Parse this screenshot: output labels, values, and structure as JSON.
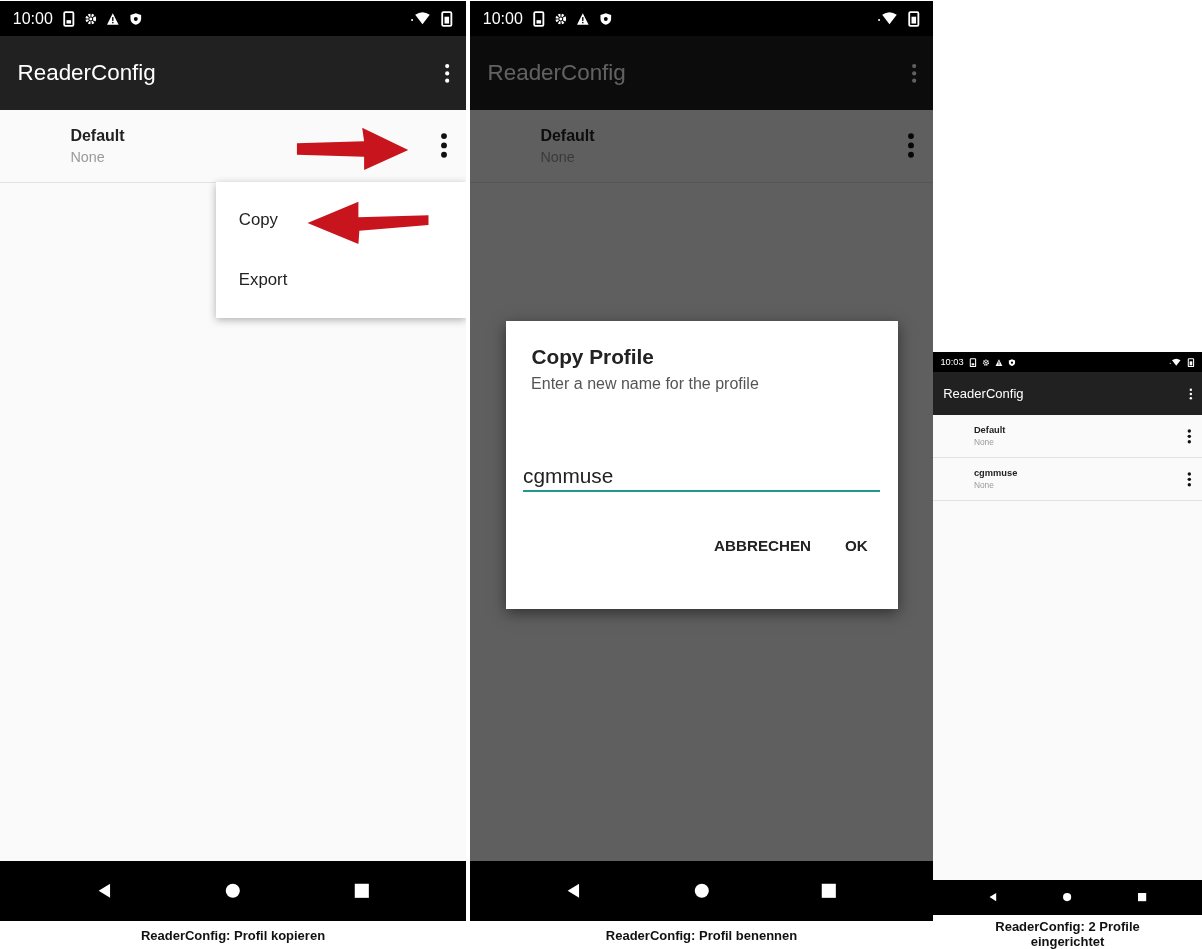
{
  "screens": [
    {
      "kind": "large",
      "status_bar": {
        "time": "10:00"
      },
      "app_bar": {
        "title": "ReaderConfig"
      },
      "profiles": [
        {
          "name": "Default",
          "subtitle": "None",
          "highlighted": true
        }
      ],
      "menu": {
        "items": [
          {
            "label": "Copy",
            "highlighted": true
          },
          {
            "label": "Export",
            "highlighted": false
          }
        ]
      },
      "caption": "ReaderConfig: Profil kopieren"
    },
    {
      "kind": "large",
      "status_bar": {
        "time": "10:00"
      },
      "app_bar": {
        "title": "ReaderConfig"
      },
      "profiles": [
        {
          "name": "Default",
          "subtitle": "None",
          "highlighted": false
        }
      ],
      "dialog": {
        "title": "Copy Profile",
        "message": "Enter a new name for the profile",
        "value": "cgmmuse",
        "buttons": [
          "ABBRECHEN",
          "OK"
        ]
      },
      "caption": "ReaderConfig: Profil benennen"
    },
    {
      "kind": "small",
      "status_bar": {
        "time": "10:03"
      },
      "app_bar": {
        "title": "ReaderConfig"
      },
      "profiles": [
        {
          "name": "Default",
          "subtitle": "None",
          "highlighted": false
        },
        {
          "name": "cgmmuse",
          "subtitle": "None",
          "highlighted": false
        }
      ],
      "caption": "ReaderConfig: 2 Profile eingerichtet"
    }
  ]
}
